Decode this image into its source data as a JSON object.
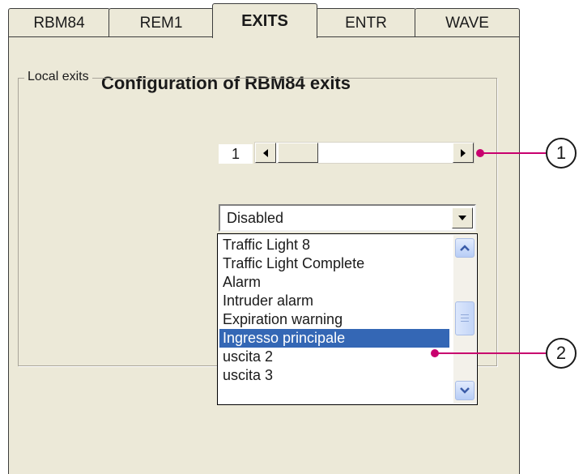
{
  "tabs": [
    {
      "label": "RBM84"
    },
    {
      "label": "REM1"
    },
    {
      "label": "EXITS"
    },
    {
      "label": "ENTR"
    },
    {
      "label": "WAVE"
    }
  ],
  "active_tab": "EXITS",
  "panel": {
    "title": "Configuration of RBM84 exits",
    "group_label": "Local exits"
  },
  "exit_selector": {
    "value": "1"
  },
  "combo": {
    "value": "Disabled"
  },
  "list": {
    "items": [
      "Traffic Light 8",
      "Traffic Light Complete",
      "Alarm",
      "Intruder alarm",
      "Expiration warning",
      "Ingresso principale",
      "uscita  2",
      "uscita  3"
    ],
    "selected": "Ingresso principale"
  },
  "callouts": {
    "c1": "1",
    "c2": "2"
  },
  "colors": {
    "selection": "#3467b5",
    "callout_line": "#c8006e",
    "window_bg": "#ece9d8"
  },
  "icons": {
    "scroll_left": "arrow-left-icon",
    "scroll_right": "arrow-right-icon",
    "combo_drop": "chevron-down-icon",
    "list_up": "chevron-up-icon",
    "list_down": "chevron-down-icon"
  }
}
